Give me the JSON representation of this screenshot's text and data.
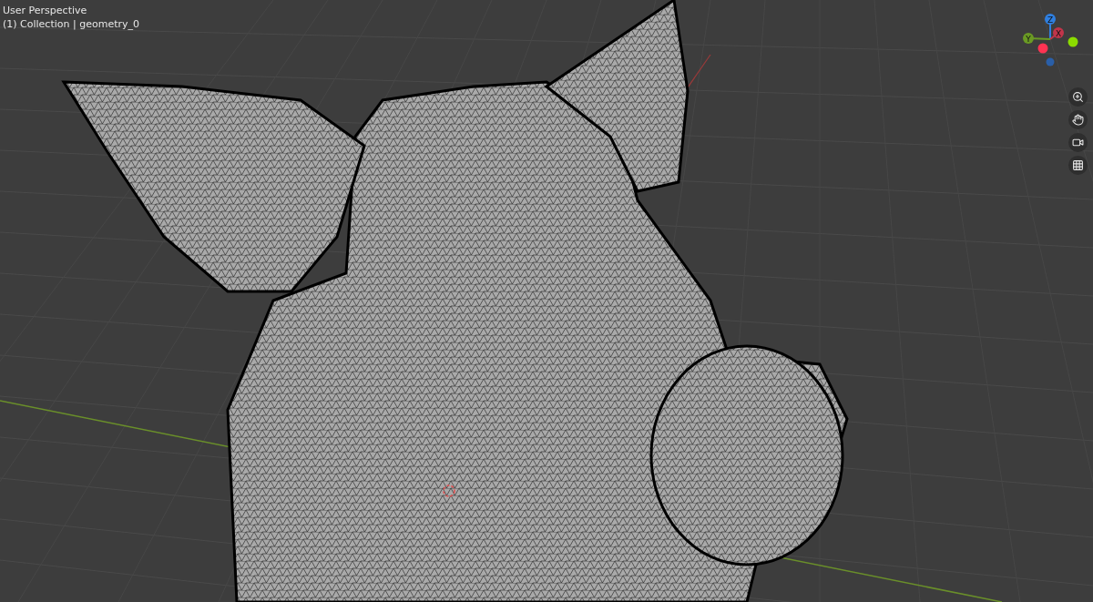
{
  "viewport": {
    "title": "User Perspective",
    "context": "(1) Collection | geometry_0"
  },
  "gizmo": {
    "axes": [
      {
        "label": "Z",
        "color": "#2f7fe0"
      },
      {
        "label": "X",
        "color": "#c0354a"
      },
      {
        "label": "Y",
        "color": "#6a9a24"
      }
    ]
  },
  "tools": [
    {
      "kind": "zoom"
    },
    {
      "kind": "pan"
    },
    {
      "kind": "camera"
    },
    {
      "kind": "grid"
    }
  ]
}
